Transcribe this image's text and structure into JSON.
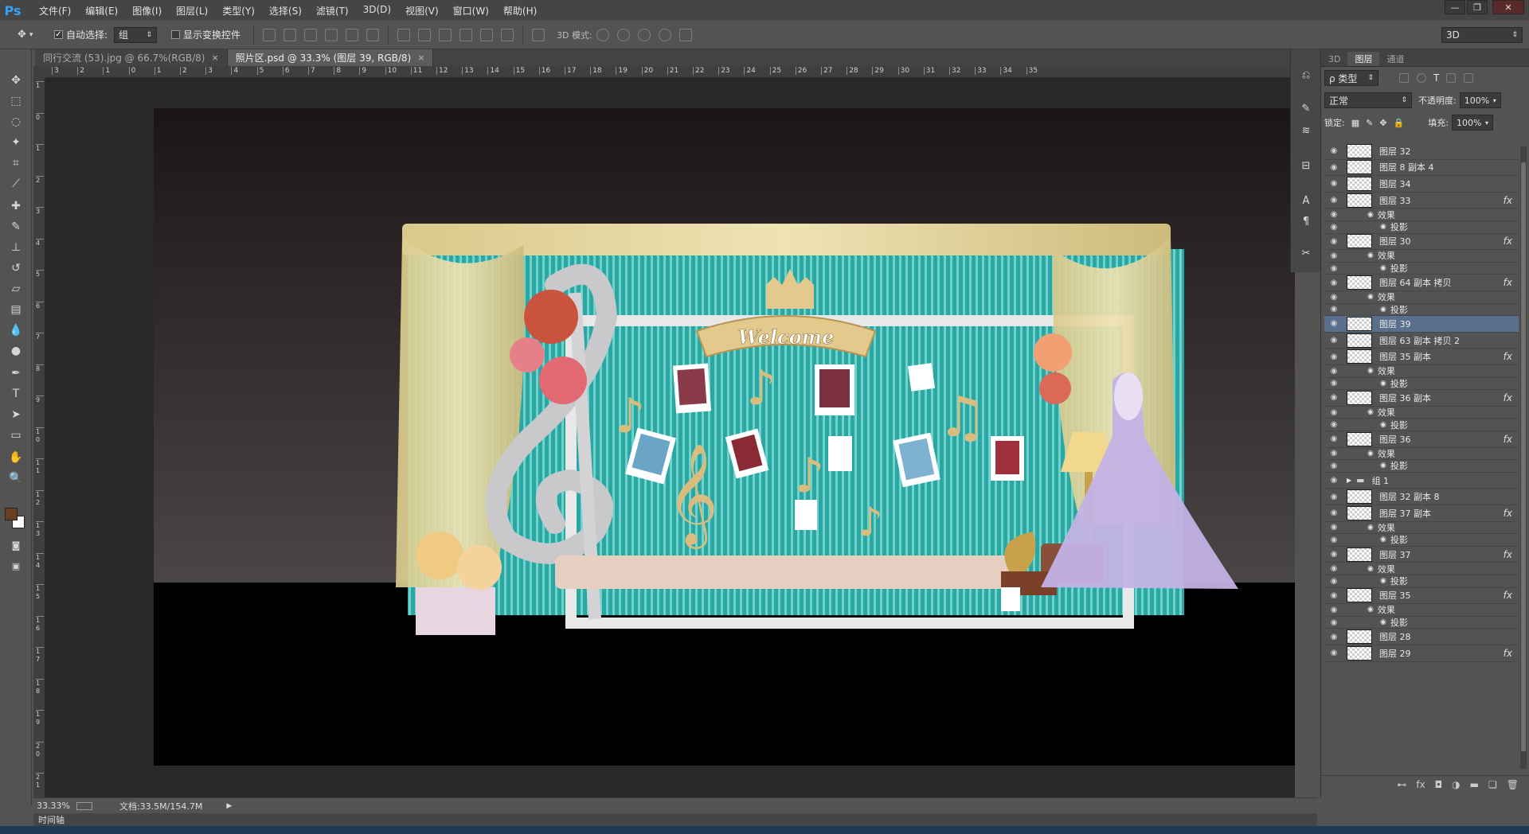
{
  "app": {
    "logo": "Ps",
    "window_controls": [
      "—",
      "❐",
      "✕"
    ]
  },
  "menu": [
    "文件(F)",
    "编辑(E)",
    "图像(I)",
    "图层(L)",
    "类型(Y)",
    "选择(S)",
    "滤镜(T)",
    "3D(D)",
    "视图(V)",
    "窗口(W)",
    "帮助(H)"
  ],
  "options": {
    "auto_select_label": "自动选择:",
    "auto_select_checked": true,
    "auto_select_value": "组",
    "show_transform_label": "显示变换控件",
    "mode_3d_label": "3D 模式:",
    "workspace": "3D"
  },
  "tabs": [
    {
      "label": "同行交流 (53).jpg @ 66.7%(RGB/8)",
      "active": false
    },
    {
      "label": "照片区.psd @ 33.3% (图层 39, RGB/8)",
      "active": true
    }
  ],
  "ruler": {
    "top": [
      "3",
      "2",
      "1",
      "0",
      "1",
      "2",
      "3",
      "4",
      "5",
      "6",
      "7",
      "8",
      "9",
      "10",
      "11",
      "12",
      "13",
      "14",
      "15",
      "16",
      "17",
      "18",
      "19",
      "20",
      "21",
      "22",
      "23",
      "24",
      "25",
      "26",
      "27",
      "28",
      "29",
      "30",
      "31",
      "32",
      "33",
      "34",
      "35"
    ],
    "left": [
      "1",
      "0",
      "1",
      "2",
      "3",
      "4",
      "5",
      "6",
      "7",
      "8",
      "9",
      "1 0",
      "1 1",
      "1 2",
      "1 3",
      "1 4",
      "1 5",
      "1 6",
      "1 7",
      "1 8",
      "1 9",
      "2 0",
      "2 1"
    ]
  },
  "canvas": {
    "welcome_text": "Welcome",
    "colors": {
      "backdrop": "#2aa6a3",
      "curtain": "#e6d8a2",
      "stage_floor": "#000000",
      "wall_top": "#1c1616",
      "banner": "#e3c98c"
    }
  },
  "status": {
    "zoom": "33.33%",
    "doc": "文档:33.5M/154.7M"
  },
  "timeline_label": "时间轴",
  "panel": {
    "tabs": [
      "3D",
      "图层",
      "通道"
    ],
    "active_tab": "图层",
    "filter_label": "ρ 类型",
    "blend_mode": "正常",
    "opacity_label": "不透明度:",
    "opacity_value": "100%",
    "lock_label": "锁定:",
    "fill_label": "填充:",
    "fill_value": "100%"
  },
  "layers": [
    {
      "type": "layer",
      "name": "图层 32",
      "fx": false
    },
    {
      "type": "layer",
      "name": "图层 8 副本 4",
      "fx": false
    },
    {
      "type": "layer",
      "name": "图层 34",
      "fx": false
    },
    {
      "type": "layer",
      "name": "图层 33",
      "fx": true
    },
    {
      "type": "effect",
      "name": "效果"
    },
    {
      "type": "sub",
      "name": "投影"
    },
    {
      "type": "layer",
      "name": "图层 30",
      "fx": true
    },
    {
      "type": "effect",
      "name": "效果"
    },
    {
      "type": "sub",
      "name": "投影"
    },
    {
      "type": "layer",
      "name": "图层 64 副本 拷贝",
      "fx": true
    },
    {
      "type": "effect",
      "name": "效果"
    },
    {
      "type": "sub",
      "name": "投影"
    },
    {
      "type": "layer",
      "name": "图层 39",
      "fx": false,
      "selected": true
    },
    {
      "type": "layer",
      "name": "图层 63 副本 拷贝 2",
      "fx": false
    },
    {
      "type": "layer",
      "name": "图层 35 副本",
      "fx": true
    },
    {
      "type": "effect",
      "name": "效果"
    },
    {
      "type": "sub",
      "name": "投影"
    },
    {
      "type": "layer",
      "name": "图层 36 副本",
      "fx": true
    },
    {
      "type": "effect",
      "name": "效果"
    },
    {
      "type": "sub",
      "name": "投影"
    },
    {
      "type": "layer",
      "name": "图层 36",
      "fx": true
    },
    {
      "type": "effect",
      "name": "效果"
    },
    {
      "type": "sub",
      "name": "投影"
    },
    {
      "type": "group",
      "name": "组 1",
      "fx": false
    },
    {
      "type": "layer",
      "name": "图层 32 副本 8",
      "fx": false
    },
    {
      "type": "layer",
      "name": "图层 37 副本",
      "fx": true
    },
    {
      "type": "effect",
      "name": "效果"
    },
    {
      "type": "sub",
      "name": "投影"
    },
    {
      "type": "layer",
      "name": "图层 37",
      "fx": true
    },
    {
      "type": "effect",
      "name": "效果"
    },
    {
      "type": "sub",
      "name": "投影"
    },
    {
      "type": "layer",
      "name": "图层 35",
      "fx": true
    },
    {
      "type": "effect",
      "name": "效果"
    },
    {
      "type": "sub",
      "name": "投影"
    },
    {
      "type": "layer",
      "name": "图层 28",
      "fx": false
    },
    {
      "type": "layer",
      "name": "图层 29",
      "fx": true
    }
  ],
  "panel_bottom_icons": [
    "link-icon",
    "fx-icon",
    "mask-icon",
    "adjustment-icon",
    "folder-icon",
    "new-layer-icon",
    "trash-icon"
  ]
}
